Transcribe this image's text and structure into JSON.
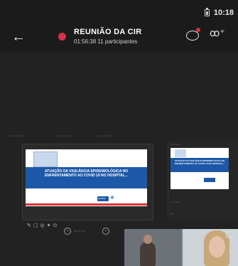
{
  "status_bar": {
    "time": "10:18"
  },
  "header": {
    "title": "REUNIÃO DA CIR",
    "duration": "01:56:38",
    "participants": "11 participantes"
  },
  "slide": {
    "title": "ATUAÇÃO DA VIGILÂNCIA EPIDEMIOLÓGICA NO ENFRENTAMENTO AO COVID 19 NO HOSPITAL...",
    "logo_text": "SAÚDE"
  },
  "icons": {
    "back": "arrow-left-icon",
    "chat": "chat-icon",
    "people": "add-people-icon",
    "record": "record-icon",
    "camera": "camera-switch-icon"
  },
  "colors": {
    "record": "#d6304a",
    "slide_banner": "#1d58a8"
  }
}
